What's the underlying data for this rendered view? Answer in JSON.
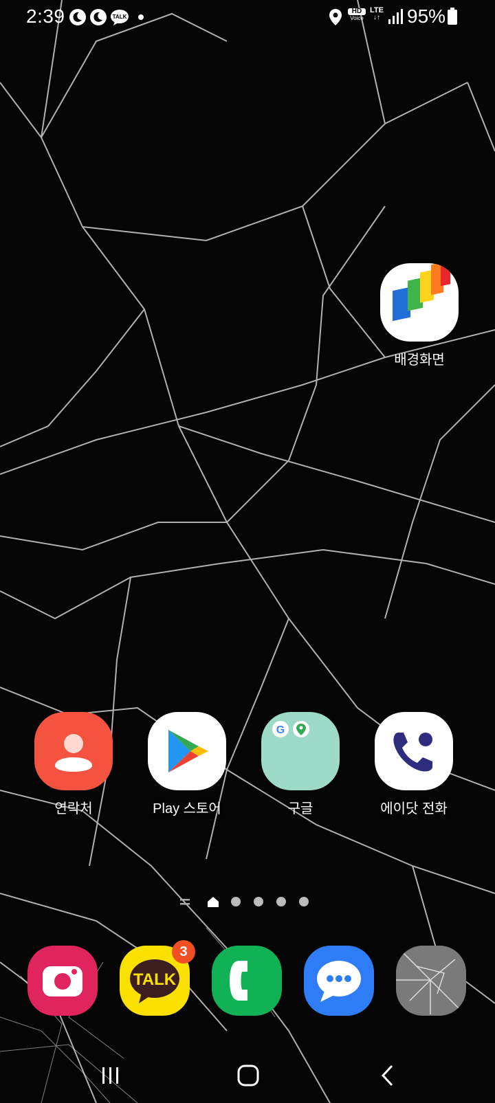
{
  "status_bar": {
    "time": "2:39",
    "hd_label": "HD",
    "voice_label": "Voice",
    "lte_label": "LTE",
    "battery_percent": "95%",
    "icons": [
      "moon-icon",
      "moon-icon",
      "kakaotalk-notification-icon",
      "dot-icon",
      "location-icon",
      "signal-icon",
      "battery-icon"
    ]
  },
  "home": {
    "widget_app": {
      "label": "배경화면",
      "icon": "wallpaper-icon"
    },
    "apps": [
      {
        "label": "연락처",
        "icon": "contacts-icon",
        "color": "#f4533f"
      },
      {
        "label": "Play 스토어",
        "icon": "play-store-icon",
        "color": "#ffffff"
      },
      {
        "label": "구글",
        "icon": "google-folder-icon",
        "color": "#9ddbc8"
      },
      {
        "label": "에이닷 전화",
        "icon": "adot-phone-icon",
        "color": "#ffffff"
      }
    ]
  },
  "page_indicator": {
    "pages": 5,
    "current": 1
  },
  "dock": {
    "apps": [
      {
        "icon": "camera-icon",
        "color": "#e0245e"
      },
      {
        "icon": "kakaotalk-icon",
        "color": "#fae100",
        "text": "TALK",
        "badge": "3"
      },
      {
        "icon": "phone-icon",
        "color": "#11b256"
      },
      {
        "icon": "messages-icon",
        "color": "#2e7cf6"
      },
      {
        "icon": "broken-glass-app-icon",
        "color": "#7a7a7a"
      }
    ]
  },
  "colors": {
    "background": "#000000",
    "text": "#ffffff"
  }
}
